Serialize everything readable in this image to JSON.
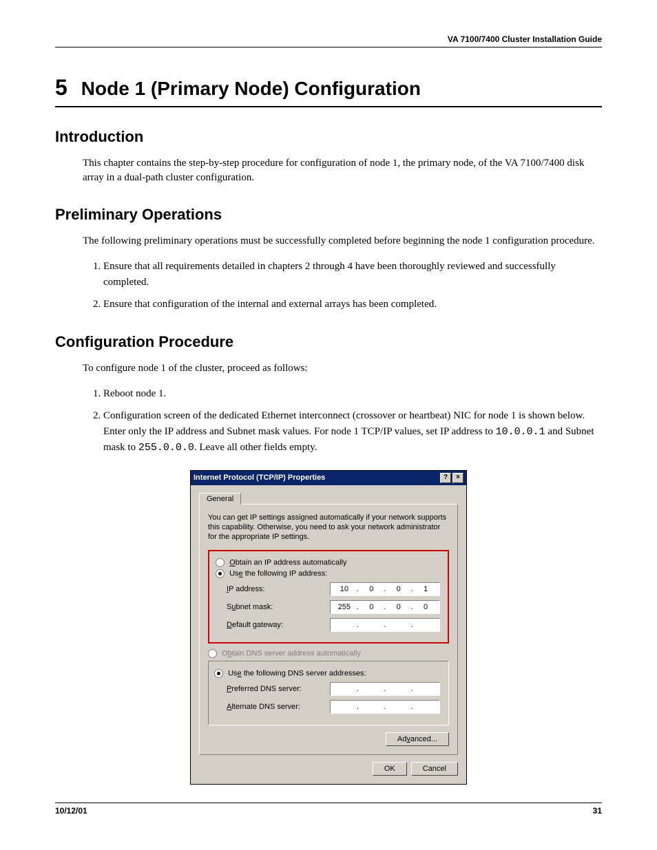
{
  "header": {
    "doc_title": "VA 7100/7400 Cluster Installation Guide"
  },
  "chapter": {
    "number": "5",
    "title": "Node 1 (Primary Node) Configuration"
  },
  "sections": {
    "intro": {
      "heading": "Introduction",
      "text": "This chapter contains the step-by-step procedure for configuration of node 1, the primary node, of the VA 7100/7400 disk array in a dual-path cluster configuration."
    },
    "prelim": {
      "heading": "Preliminary Operations",
      "lead": "The following preliminary operations must be successfully completed before beginning the node 1 configuration procedure.",
      "items": [
        "Ensure that all requirements detailed in chapters 2 through 4 have been thoroughly reviewed and successfully completed.",
        "Ensure that configuration of the internal and external arrays has been completed."
      ]
    },
    "config": {
      "heading": "Configuration Procedure",
      "lead": "To configure node 1 of the cluster, proceed as follows:",
      "step1": "Reboot node 1.",
      "step2_a": "Configuration screen of the dedicated Ethernet interconnect (crossover or heartbeat) NIC for node 1 is shown below.  Enter only the IP address and Subnet mask values.  For node 1 TCP/IP values, set IP address to ",
      "step2_ip": "10.0.0.1",
      "step2_b": " and Subnet mask to ",
      "step2_mask": "255.0.0.0",
      "step2_c": ".  Leave all other fields empty."
    }
  },
  "dialog": {
    "title": "Internet Protocol (TCP/IP) Properties",
    "help_btn": "?",
    "close_btn": "×",
    "tab": "General",
    "info": "You can get IP settings assigned automatically if your network supports this capability. Otherwise, you need to ask your network administrator for the appropriate IP settings.",
    "radio_auto_ip_pre": "O",
    "radio_auto_ip_post": "btain an IP address automatically",
    "radio_use_ip_pre": "Us",
    "radio_use_ip_key": "e",
    "radio_use_ip_post": " the following IP address:",
    "ip_label_pre": "I",
    "ip_label_post": "P address:",
    "ip_value": [
      "10",
      "0",
      "0",
      "1"
    ],
    "subnet_label_pre": "S",
    "subnet_label_key": "u",
    "subnet_label_post": "bnet mask:",
    "subnet_value": [
      "255",
      "0",
      "0",
      "0"
    ],
    "gateway_label_pre": "D",
    "gateway_label_post": "efault gateway:",
    "gateway_value": [
      "",
      "",
      "",
      ""
    ],
    "radio_auto_dns_pre": "O",
    "radio_auto_dns_key": "b",
    "radio_auto_dns_post": "tain DNS server address automatically",
    "radio_use_dns_pre": "Us",
    "radio_use_dns_key": "e",
    "radio_use_dns_post": " the following DNS server addresses:",
    "pref_dns_label_pre": "P",
    "pref_dns_label_post": "referred DNS server:",
    "pref_dns_value": [
      "",
      "",
      "",
      ""
    ],
    "alt_dns_label_pre": "A",
    "alt_dns_label_post": "lternate DNS server:",
    "alt_dns_value": [
      "",
      "",
      "",
      ""
    ],
    "advanced_pre": "Ad",
    "advanced_key": "v",
    "advanced_post": "anced...",
    "ok": "OK",
    "cancel": "Cancel"
  },
  "footer": {
    "date": "10/12/01",
    "page": "31"
  }
}
